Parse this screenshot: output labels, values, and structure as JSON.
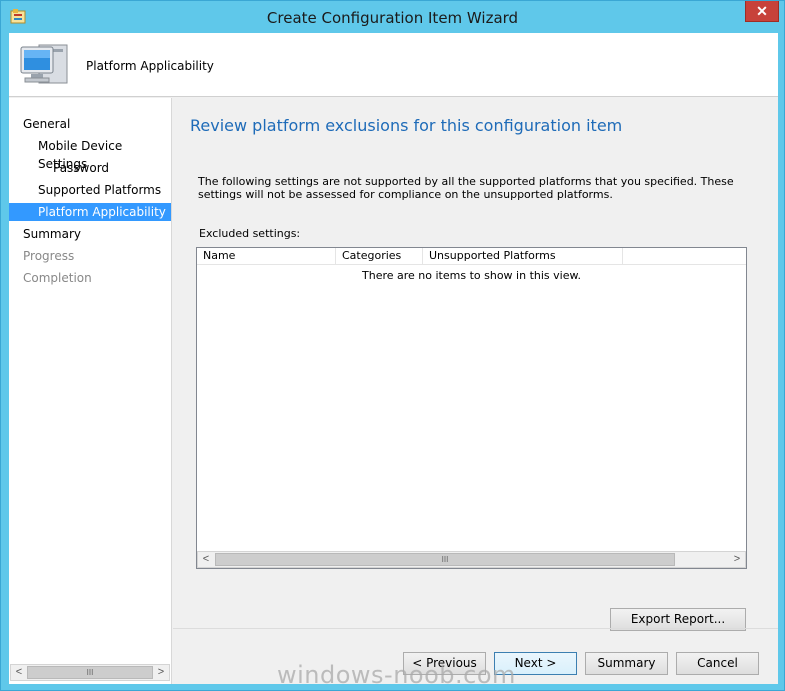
{
  "window": {
    "title": "Create Configuration Item Wizard",
    "close_label": "✕"
  },
  "header": {
    "title": "Platform Applicability"
  },
  "nav": {
    "items": [
      {
        "label": "General"
      },
      {
        "label": "Mobile Device Settings"
      },
      {
        "label": "Password"
      },
      {
        "label": "Supported Platforms"
      },
      {
        "label": "Platform Applicability",
        "selected": true
      },
      {
        "label": "Summary"
      },
      {
        "label": "Progress"
      },
      {
        "label": "Completion"
      }
    ],
    "scroll_thumb": "III"
  },
  "content": {
    "title": "Review platform exclusions for this configuration item",
    "description": "The following settings are not supported by all the supported platforms that you specified. These settings will not be assessed for compliance on the unsupported platforms.",
    "excluded_label": "Excluded settings:",
    "list": {
      "columns": [
        "Name",
        "Categories",
        "Unsupported Platforms"
      ],
      "empty_text": "There are no items to show in this view.",
      "scroll_thumb": "III"
    },
    "export_button": "Export Report..."
  },
  "footer": {
    "previous": "< Previous",
    "next": "Next >",
    "summary": "Summary",
    "cancel": "Cancel"
  },
  "watermark": "windows-noob.com",
  "colors": {
    "title_bar": "#5fc8ea",
    "selection": "#3399ff",
    "heading": "#1e6bb8",
    "close": "#c7423a"
  }
}
